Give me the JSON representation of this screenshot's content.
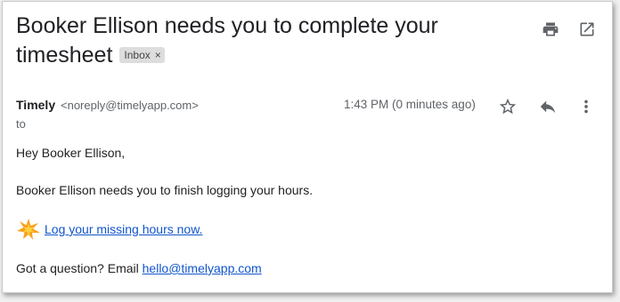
{
  "email": {
    "subject": "Booker Ellison needs you to complete your timesheet",
    "label": "Inbox",
    "label_remove": "×",
    "sender_name": "Timely",
    "sender_email": "<noreply@timelyapp.com>",
    "to_label": "to",
    "timestamp": "1:43 PM (0 minutes ago)",
    "greeting": "Hey Booker Ellison,",
    "message": "Booker Ellison needs you to finish logging your hours.",
    "cta_link": "Log your missing hours now.",
    "question_prefix": "Got a question? Email ",
    "question_email": "hello@timelyapp.com"
  },
  "icons": {
    "print": "print-icon",
    "open_new_window": "open-in-new-window-icon",
    "star": "star-icon",
    "reply": "reply-icon",
    "more": "more-vert-icon",
    "sparkle": "sparkle-emoji-icon"
  },
  "colors": {
    "link": "#1155cc",
    "icon": "#5f6368",
    "chip_bg": "#dddddd",
    "sparkle": "#f7a21b"
  }
}
